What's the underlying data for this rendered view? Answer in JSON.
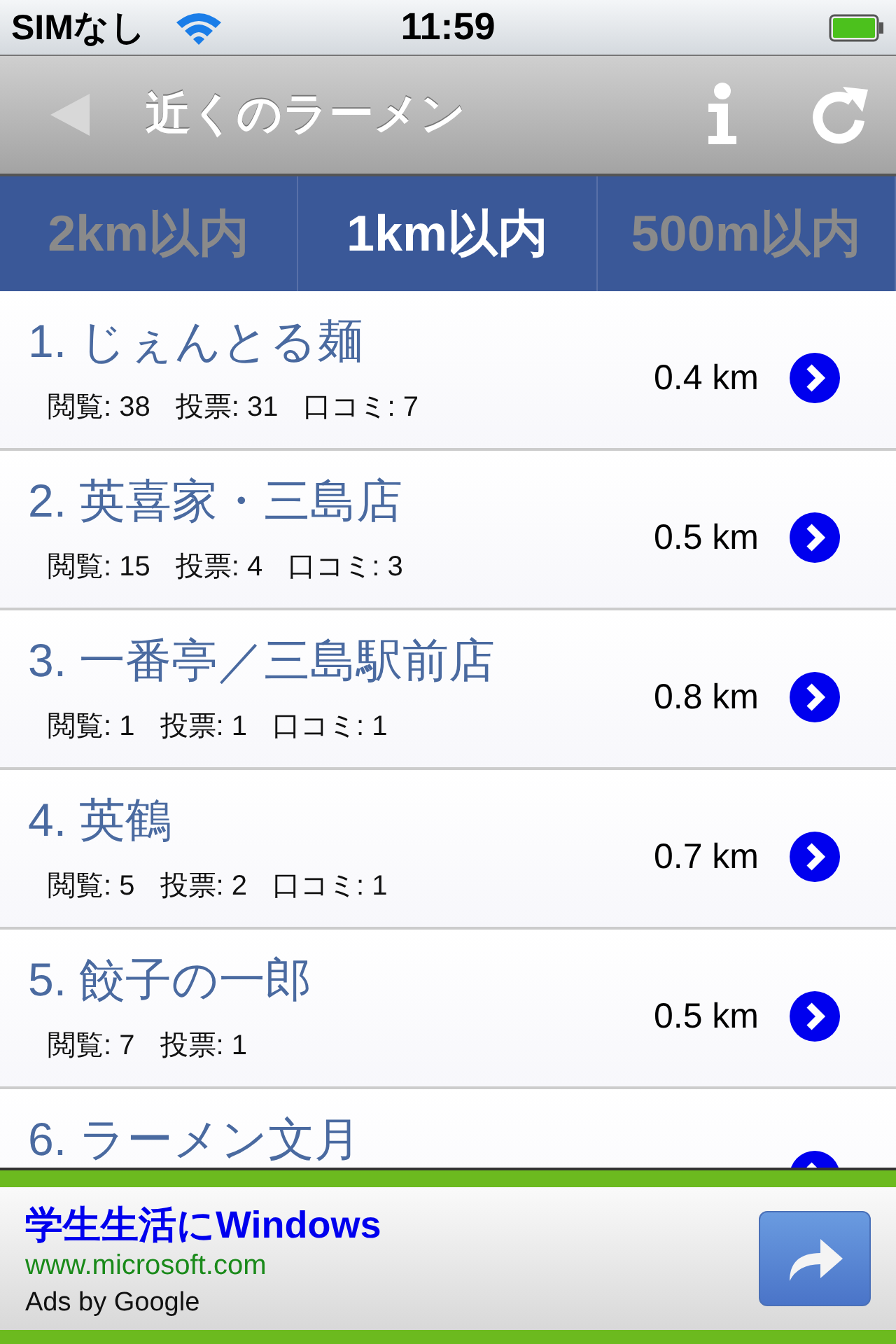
{
  "status_bar": {
    "carrier": "SIMなし",
    "time": "11:59"
  },
  "nav_bar": {
    "title": "近くのラーメン"
  },
  "tabs": [
    {
      "label": "2km以内",
      "selected": false
    },
    {
      "label": "1km以内",
      "selected": true
    },
    {
      "label": "500m以内",
      "selected": false
    }
  ],
  "results": [
    {
      "name": "1. じぇんとる麺",
      "stats": [
        "閲覧: 38",
        "投票: 31",
        "口コミ: 7"
      ],
      "distance": "0.4 km"
    },
    {
      "name": "2. 英喜家・三島店",
      "stats": [
        "閲覧: 15",
        "投票: 4",
        "口コミ: 3"
      ],
      "distance": "0.5 km"
    },
    {
      "name": "3. 一番亭／三島駅前店",
      "stats": [
        "閲覧: 1",
        "投票: 1",
        "口コミ: 1"
      ],
      "distance": "0.8 km"
    },
    {
      "name": "4. 英鶴",
      "stats": [
        "閲覧: 5",
        "投票: 2",
        "口コミ: 1"
      ],
      "distance": "0.7 km"
    },
    {
      "name": "5. 餃子の一郎",
      "stats": [
        "閲覧: 7",
        "投票: 1"
      ],
      "distance": "0.5 km"
    },
    {
      "name": "6. ラーメン文月"
    }
  ],
  "ad": {
    "headline": "学生生活にWindows",
    "url": "www.microsoft.com",
    "attribution": "Ads by Google"
  }
}
